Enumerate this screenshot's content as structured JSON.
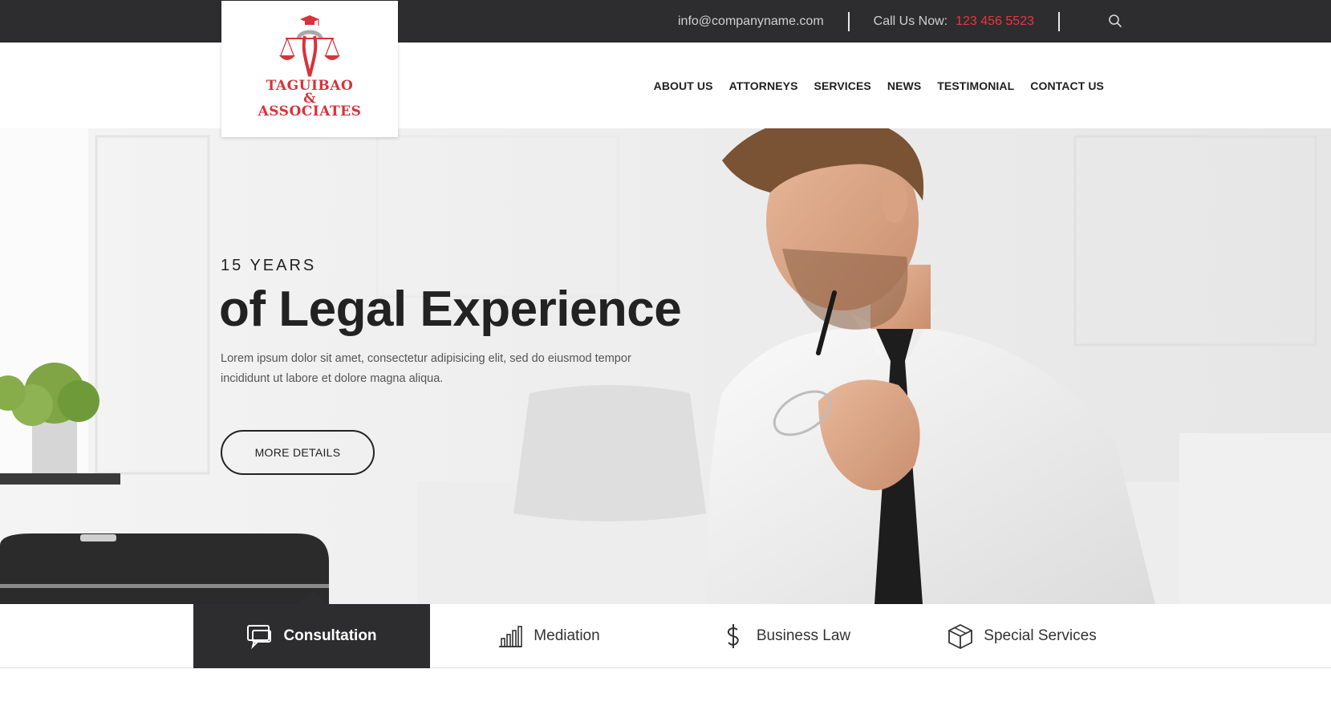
{
  "topbar": {
    "email": "info@companyname.com",
    "call_label": "Call Us Now:",
    "call_number": "123 456 5523",
    "search_icon": "search-icon",
    "accent_color": "#e8373f",
    "background": "#2d2d2f"
  },
  "logo": {
    "line1": "TAGUIBAO",
    "line2": "&",
    "line3": "ASSOCIATES",
    "icon": "scales-of-justice-icon",
    "color": "#d8323a"
  },
  "nav": {
    "items": [
      {
        "label": "ABOUT US"
      },
      {
        "label": "ATTORNEYS"
      },
      {
        "label": "SERVICES"
      },
      {
        "label": "NEWS"
      },
      {
        "label": "TESTIMONIAL"
      },
      {
        "label": "CONTACT US"
      }
    ]
  },
  "hero": {
    "subtitle": "15 YEARS",
    "title": "of Legal Experience",
    "text": "Lorem ipsum dolor sit amet, consectetur adipisicing elit, sed do eiusmod tempor incididunt ut labore et dolore magna aliqua.",
    "button_label": "MORE DETAILS"
  },
  "services": {
    "items": [
      {
        "label": "Consultation",
        "icon": "chat-bubbles-icon",
        "active": true
      },
      {
        "label": "Mediation",
        "icon": "bar-chart-icon",
        "active": false
      },
      {
        "label": "Business Law",
        "icon": "dollar-icon",
        "active": false
      },
      {
        "label": "Special Services",
        "icon": "box-icon",
        "active": false
      }
    ],
    "active_background": "#2d2d2f"
  }
}
